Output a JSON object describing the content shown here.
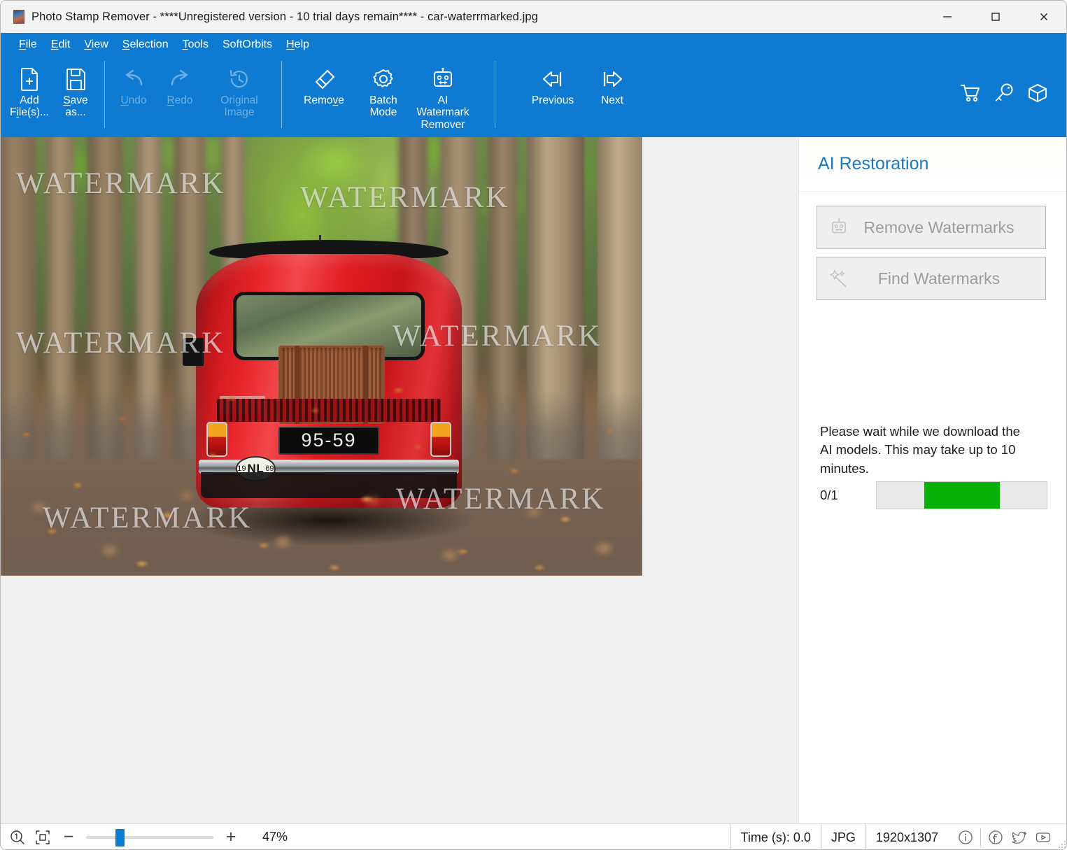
{
  "window": {
    "title": "Photo Stamp Remover - ****Unregistered version - 10 trial days remain**** - car-waterrmarked.jpg",
    "minimize_label": "Minimize",
    "maximize_label": "Maximize",
    "close_label": "Close"
  },
  "menu": {
    "items": [
      {
        "label": "File",
        "accel": "F"
      },
      {
        "label": "Edit",
        "accel": "E"
      },
      {
        "label": "View",
        "accel": "V"
      },
      {
        "label": "Selection",
        "accel": "S"
      },
      {
        "label": "Tools",
        "accel": "T"
      },
      {
        "label": "SoftOrbits",
        "accel": ""
      },
      {
        "label": "Help",
        "accel": "H"
      }
    ]
  },
  "toolbar": {
    "add_files_line1": "Add",
    "add_files_line2": "File(s)...",
    "save_as_line1": "Save",
    "save_as_line2": "as...",
    "undo": "Undo",
    "redo": "Redo",
    "original_image_line1": "Original",
    "original_image_line2": "Image",
    "remove": "Remove",
    "batch_mode_line1": "Batch",
    "batch_mode_line2": "Mode",
    "ai_watermark_line1": "AI",
    "ai_watermark_line2": "Watermark",
    "ai_watermark_line3": "Remover",
    "previous": "Previous",
    "next": "Next",
    "right_icons": [
      "cart-icon",
      "key-icon",
      "box-icon"
    ],
    "accent_color": "#0e7ad2"
  },
  "image": {
    "watermark_text": "WATERMARK",
    "license_plate": "95-59",
    "country_oval": "NL",
    "country_year_left": "19",
    "country_year_right": "69"
  },
  "panel": {
    "title": "AI Restoration",
    "remove_watermarks_label": "Remove Watermarks",
    "remove_watermarks_icon": "robot-icon",
    "remove_watermarks_enabled": false,
    "find_watermarks_label": "Find Watermarks",
    "find_watermarks_icon": "magic-wand-icon",
    "find_watermarks_enabled": false,
    "wait_message": "Please wait while we download the AI models. This may take up to 10 minutes.",
    "progress_count": "0/1",
    "progress_color": "#06b006",
    "progress_indeterminate": true
  },
  "statusbar": {
    "zoom_actual_icon": "zoom-actual-size-icon",
    "fit_icon": "fit-to-window-icon",
    "zoom_out_label": "−",
    "zoom_in_label": "+",
    "zoom_value": "47%",
    "zoom_slider_percent": 23,
    "time_label": "Time (s): 0.0",
    "format_label": "JPG",
    "dimensions_label": "1920x1307",
    "info_icon": "info-icon",
    "facebook_icon": "facebook-icon",
    "twitter_icon": "twitter-icon",
    "youtube_icon": "youtube-icon"
  }
}
